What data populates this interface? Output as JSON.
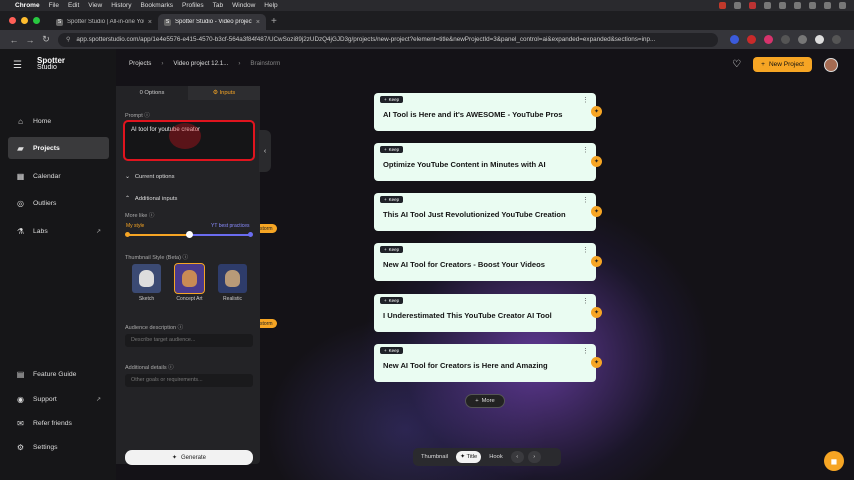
{
  "menubar": {
    "apple": "",
    "app": "Chrome",
    "items": [
      "File",
      "Edit",
      "View",
      "History",
      "Bookmarks",
      "Profiles",
      "Tab",
      "Window",
      "Help"
    ]
  },
  "tabs": [
    {
      "label": "Spotter Studio | All-in-one YouTube",
      "icon": "S"
    },
    {
      "label": "Spotter Studio - Video project 12.1",
      "icon": "S"
    }
  ],
  "address": {
    "url": "app.spotterstudio.com/app/1e4e5576-e415-4570-b3cf-564a3f84f487/UCwSozi89j2zUDzQ4jGJD3g/projects/new-project?element=title&newProjectId=3&panel_control=ai&expanded=expanded&sections=inp..."
  },
  "brand": {
    "line1": "Spotter",
    "line2": "Studio"
  },
  "sidebar": {
    "items": [
      {
        "label": "Home",
        "icon": "home-icon"
      },
      {
        "label": "Projects",
        "icon": "folder-icon"
      },
      {
        "label": "Calendar",
        "icon": "calendar-icon"
      },
      {
        "label": "Outliers",
        "icon": "outliers-icon"
      },
      {
        "label": "Labs",
        "icon": "labs-icon"
      }
    ],
    "footer": [
      {
        "label": "Feature Guide",
        "icon": "guide-icon"
      },
      {
        "label": "Support",
        "icon": "support-icon"
      },
      {
        "label": "Refer friends",
        "icon": "gift-icon"
      },
      {
        "label": "Settings",
        "icon": "gear-icon"
      }
    ]
  },
  "breadcrumb": {
    "projects": "Projects",
    "video": "Video project 12.1...",
    "current": "Brainstorm"
  },
  "header": {
    "new_project": "New Project"
  },
  "panel": {
    "tab_options": "0 Options",
    "tab_inputs": "Inputs",
    "prompt_label": "Prompt",
    "prompt_value": "AI tool for youtube creator",
    "current_options": "Current options",
    "additional_inputs": "Additional inputs",
    "more_like": "More like",
    "my_style": "My style",
    "yt_best": "YT best practices",
    "slider_value": 0.5,
    "thumb_style": "Thumbnail Style (Beta)",
    "styles": [
      "Sketch",
      "Concept Art",
      "Realistic"
    ],
    "audience_label": "Audience description",
    "audience_placeholder": "Describe target audience...",
    "details_label": "Additional details",
    "details_placeholder": "Other goals or requirements...",
    "generate": "Generate"
  },
  "pills": [
    "Title",
    "Brainstorm",
    "Brainstorm"
  ],
  "pills_visible": [
    "tle",
    "storm",
    "storm"
  ],
  "cards": {
    "keep_label": "Keep",
    "titles": [
      "AI Tool is Here and it's AWESOME - YouTube Pros",
      "Optimize YouTube Content in Minutes with AI",
      "This AI Tool Just Revolutionized YouTube Creation",
      "New AI Tool for Creators - Boost Your Videos",
      "I Underestimated This YouTube Creator AI Tool",
      "New AI Tool for Creators is Here and Amazing"
    ]
  },
  "more": "More",
  "bottombar": {
    "thumbnail": "Thumbnail",
    "title": "Title",
    "hook": "Hook"
  },
  "colors": {
    "accent": "#f6a524",
    "card_bg": "#eafcf2",
    "highlight_red": "#e0141e"
  }
}
